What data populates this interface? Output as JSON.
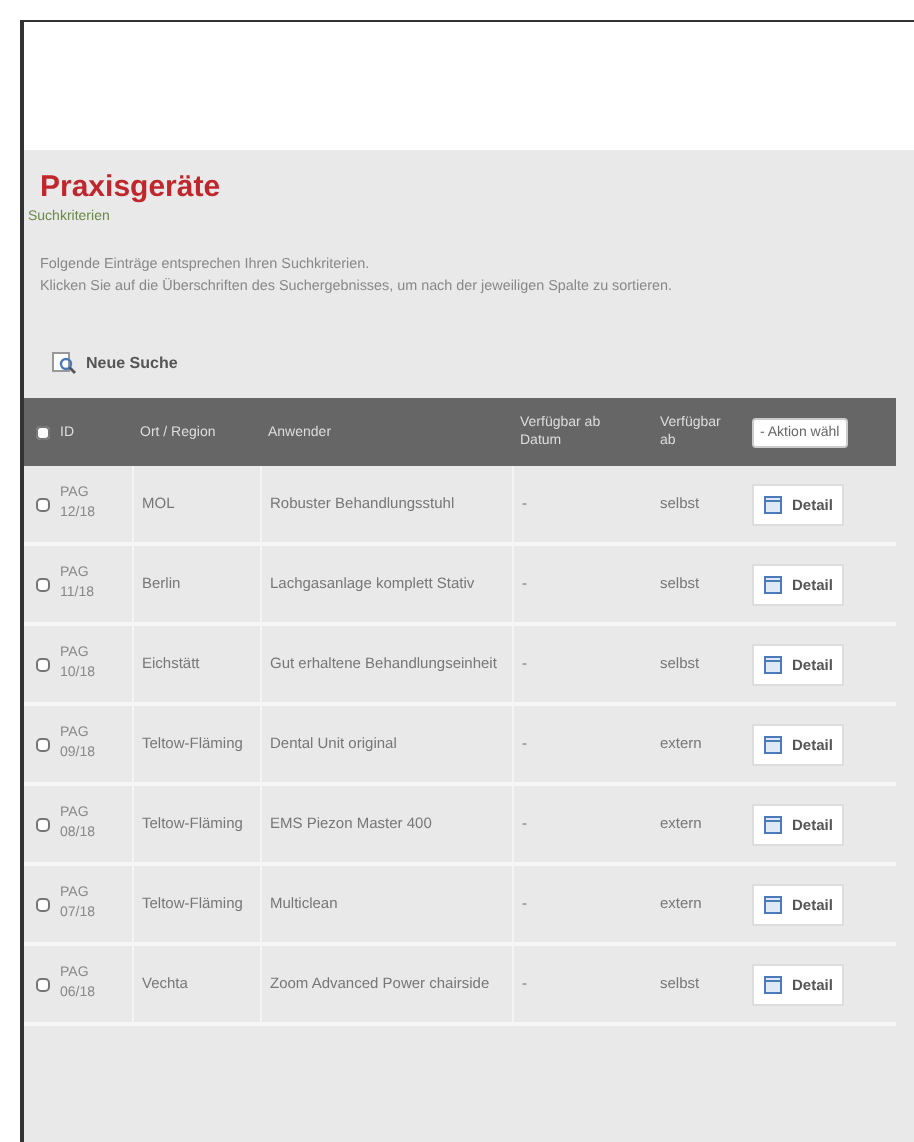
{
  "page": {
    "title": "Praxisgeräte",
    "breadcrumb": "Suchkriterien",
    "intro": [
      "Folgende Einträge entsprechen Ihren Suchkriterien.",
      "Klicken Sie auf die Überschriften des Suchergebnisses, um nach der jeweiligen Spalte zu sortieren."
    ]
  },
  "new_search": {
    "label": "Neue Suche"
  },
  "table": {
    "select_all": {
      "checked": false
    },
    "columns": [
      "ID",
      "Ort / Region",
      "Anwender",
      "Verfügbar ab Datum",
      "Verfügbar ab"
    ],
    "action_select": {
      "value": "- Aktion wähl"
    },
    "rows": [
      {
        "checked": false,
        "id": "PAG 12/18",
        "region": "MOL",
        "title": "Robuster Behandlungsstuhl",
        "date": "-",
        "available": "selbst",
        "action": "Detail"
      },
      {
        "checked": false,
        "id": "PAG 11/18",
        "region": "Berlin",
        "title": "Lachgasanlage komplett Stativ",
        "date": "-",
        "available": "selbst",
        "action": "Detail"
      },
      {
        "checked": false,
        "id": "PAG 10/18",
        "region": "Eichstätt",
        "title": "Gut erhaltene Behandlungseinheit",
        "date": "-",
        "available": "selbst",
        "action": "Detail"
      },
      {
        "checked": false,
        "id": "PAG 09/18",
        "region": "Teltow-Fläming",
        "title": "Dental Unit original",
        "date": "-",
        "available": "extern",
        "action": "Detail"
      },
      {
        "checked": false,
        "id": "PAG 08/18",
        "region": "Teltow-Fläming",
        "title": "EMS Piezon Master 400",
        "date": "-",
        "available": "extern",
        "action": "Detail"
      },
      {
        "checked": false,
        "id": "PAG 07/18",
        "region": "Teltow-Fläming",
        "title": "Multiclean",
        "date": "-",
        "available": "extern",
        "action": "Detail"
      },
      {
        "checked": false,
        "id": "PAG 06/18",
        "region": "Vechta",
        "title": "Zoom Advanced Power chairside",
        "date": "-",
        "available": "selbst",
        "action": "Detail"
      }
    ]
  }
}
